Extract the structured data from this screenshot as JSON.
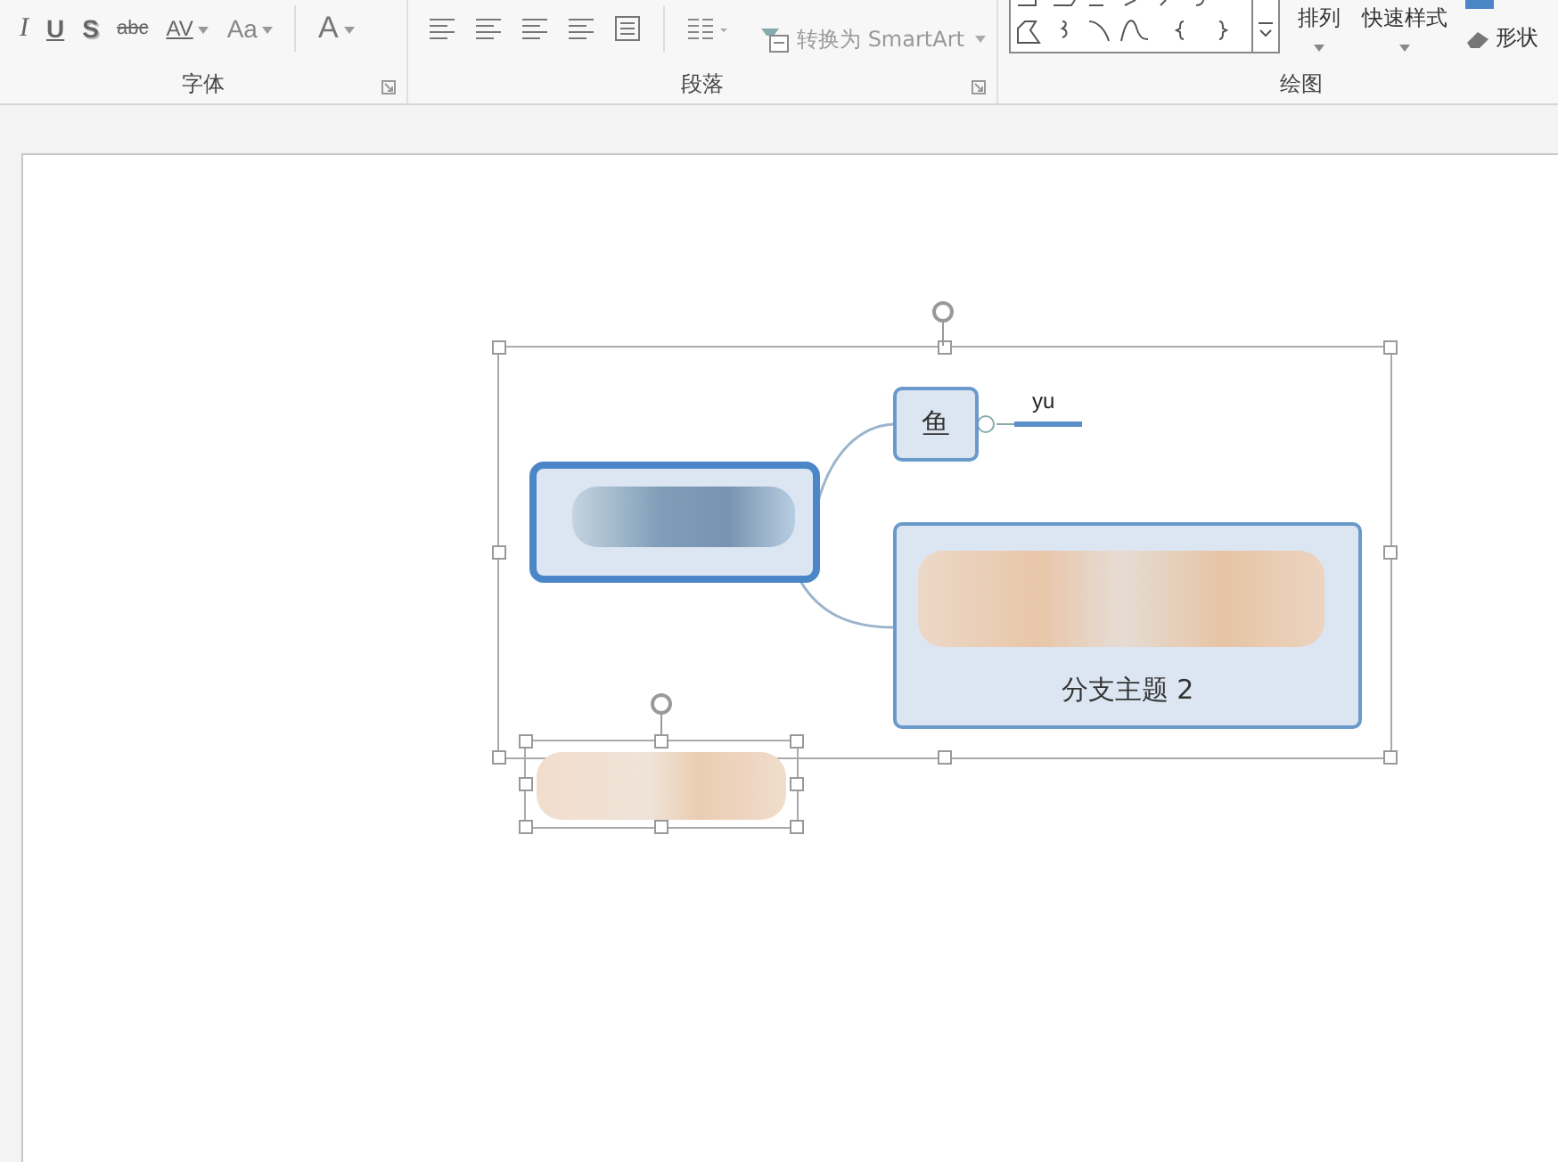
{
  "ribbon": {
    "font_group": {
      "label": "字体",
      "buttons": [
        {
          "kind": "italic",
          "text": "I",
          "dropdown": false
        },
        {
          "kind": "underline",
          "text": "U",
          "dropdown": false
        },
        {
          "kind": "shadow",
          "text": "S",
          "dropdown": false
        },
        {
          "kind": "strike",
          "text": "abc",
          "dropdown": false
        },
        {
          "kind": "spacing",
          "text": "AV",
          "dropdown": true
        },
        {
          "kind": "case",
          "text": "Aa",
          "dropdown": true
        },
        {
          "kind": "color",
          "text": "A",
          "dropdown": true
        }
      ]
    },
    "paragraph_group": {
      "label": "段落",
      "smartart": "转换为 SmartArt"
    },
    "drawing_group": {
      "label": "绘图",
      "arrange": "排列",
      "quick_styles": "快速样式",
      "shape_effects": "形状"
    }
  },
  "diagram": {
    "topic": "鱼",
    "topic_label": "yu",
    "branch": "分支主题 2"
  }
}
